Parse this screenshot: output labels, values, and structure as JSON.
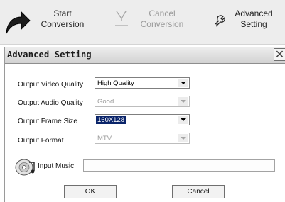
{
  "toolbar": {
    "start": {
      "label": "Start\nConversion",
      "icon": "arrow-icon",
      "enabled": true
    },
    "cancel": {
      "label": "Cancel\nConversion",
      "icon": "cancel-icon",
      "enabled": false
    },
    "advanced": {
      "label": "Advanced\nSetting",
      "icon": "settings-icon",
      "enabled": true
    }
  },
  "dialog": {
    "title": "Advanced Setting",
    "close_icon": "close-icon",
    "fields": {
      "video_quality": {
        "label": "Output Video Quality",
        "value": "High Quality",
        "enabled": true
      },
      "audio_quality": {
        "label": "Output Audio Quality",
        "value": "Good",
        "enabled": false
      },
      "frame_size": {
        "label": "Output Frame Size",
        "value": "160X128",
        "enabled": true,
        "focused": true
      },
      "format": {
        "label": "Output Format",
        "value": "MTV",
        "enabled": false
      }
    },
    "input_music": {
      "label": "Input Music",
      "value": "",
      "icon": "music-disc-icon"
    },
    "buttons": {
      "ok": "OK",
      "cancel": "Cancel"
    }
  },
  "colors": {
    "toolbar_bg": "#ededed",
    "disabled_text": "#9c9c9c",
    "selection_bg": "#0a246a"
  }
}
